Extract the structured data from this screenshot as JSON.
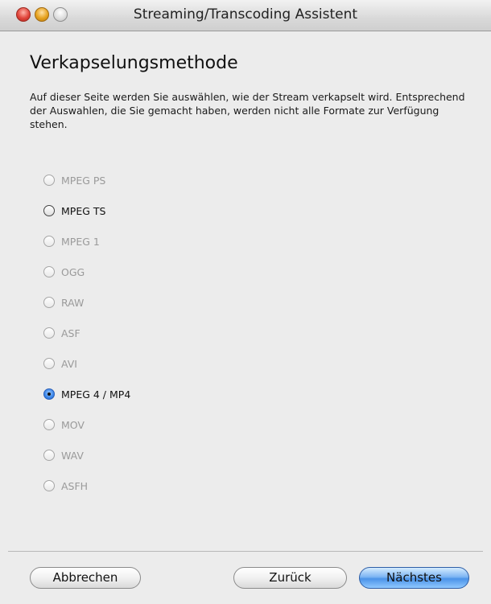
{
  "window": {
    "title": "Streaming/Transcoding Assistent"
  },
  "page": {
    "heading": "Verkapselungsmethode",
    "description": "Auf dieser Seite werden Sie auswählen, wie der Stream verkapselt wird. Entsprechend der Auswahlen, die Sie gemacht haben, werden nicht alle Formate zur Verfügung stehen."
  },
  "options": [
    {
      "label": "MPEG PS",
      "enabled": false,
      "selected": false
    },
    {
      "label": "MPEG TS",
      "enabled": true,
      "selected": false
    },
    {
      "label": "MPEG 1",
      "enabled": false,
      "selected": false
    },
    {
      "label": "OGG",
      "enabled": false,
      "selected": false
    },
    {
      "label": "RAW",
      "enabled": false,
      "selected": false
    },
    {
      "label": "ASF",
      "enabled": false,
      "selected": false
    },
    {
      "label": "AVI",
      "enabled": false,
      "selected": false
    },
    {
      "label": "MPEG 4 / MP4",
      "enabled": true,
      "selected": true
    },
    {
      "label": "MOV",
      "enabled": false,
      "selected": false
    },
    {
      "label": "WAV",
      "enabled": false,
      "selected": false
    },
    {
      "label": "ASFH",
      "enabled": false,
      "selected": false
    }
  ],
  "buttons": {
    "cancel": "Abbrechen",
    "back": "Zurück",
    "next": "Nächstes"
  },
  "colors": {
    "default_button": "#4b93e8",
    "disabled_text": "#9a9a9a",
    "enabled_text": "#111111"
  }
}
